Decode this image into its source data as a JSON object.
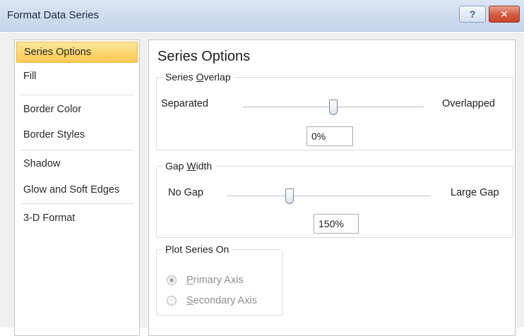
{
  "window": {
    "title": "Format Data Series",
    "help_glyph": "?",
    "close_glyph": "✕"
  },
  "sidebar": {
    "items": [
      {
        "label": "Series Options",
        "selected": true
      },
      {
        "label": "Fill"
      },
      {
        "label": "Border Color"
      },
      {
        "label": "Border Styles"
      },
      {
        "label": "Shadow"
      },
      {
        "label": "Glow and Soft Edges"
      },
      {
        "label": "3-D Format"
      }
    ]
  },
  "main": {
    "title": "Series Options",
    "series_overlap": {
      "legend_pre": "Series ",
      "legend_key": "O",
      "legend_post": "verlap",
      "min_label": "Separated",
      "max_label": "Overlapped",
      "value": "0%"
    },
    "gap_width": {
      "legend_pre": "Gap ",
      "legend_key": "W",
      "legend_post": "idth",
      "min_label": "No Gap",
      "max_label": "Large Gap",
      "value": "150%"
    },
    "plot_series_on": {
      "legend": "Plot Series On",
      "primary_key": "P",
      "primary_rest": "rimary Axis",
      "secondary_key": "S",
      "secondary_rest": "econdary Axis",
      "selected": "primary",
      "disabled": true
    }
  },
  "colors": {
    "selected_item": "#fcd46d",
    "titlebar": "#cfdcee",
    "close_button": "#d35a3e"
  }
}
